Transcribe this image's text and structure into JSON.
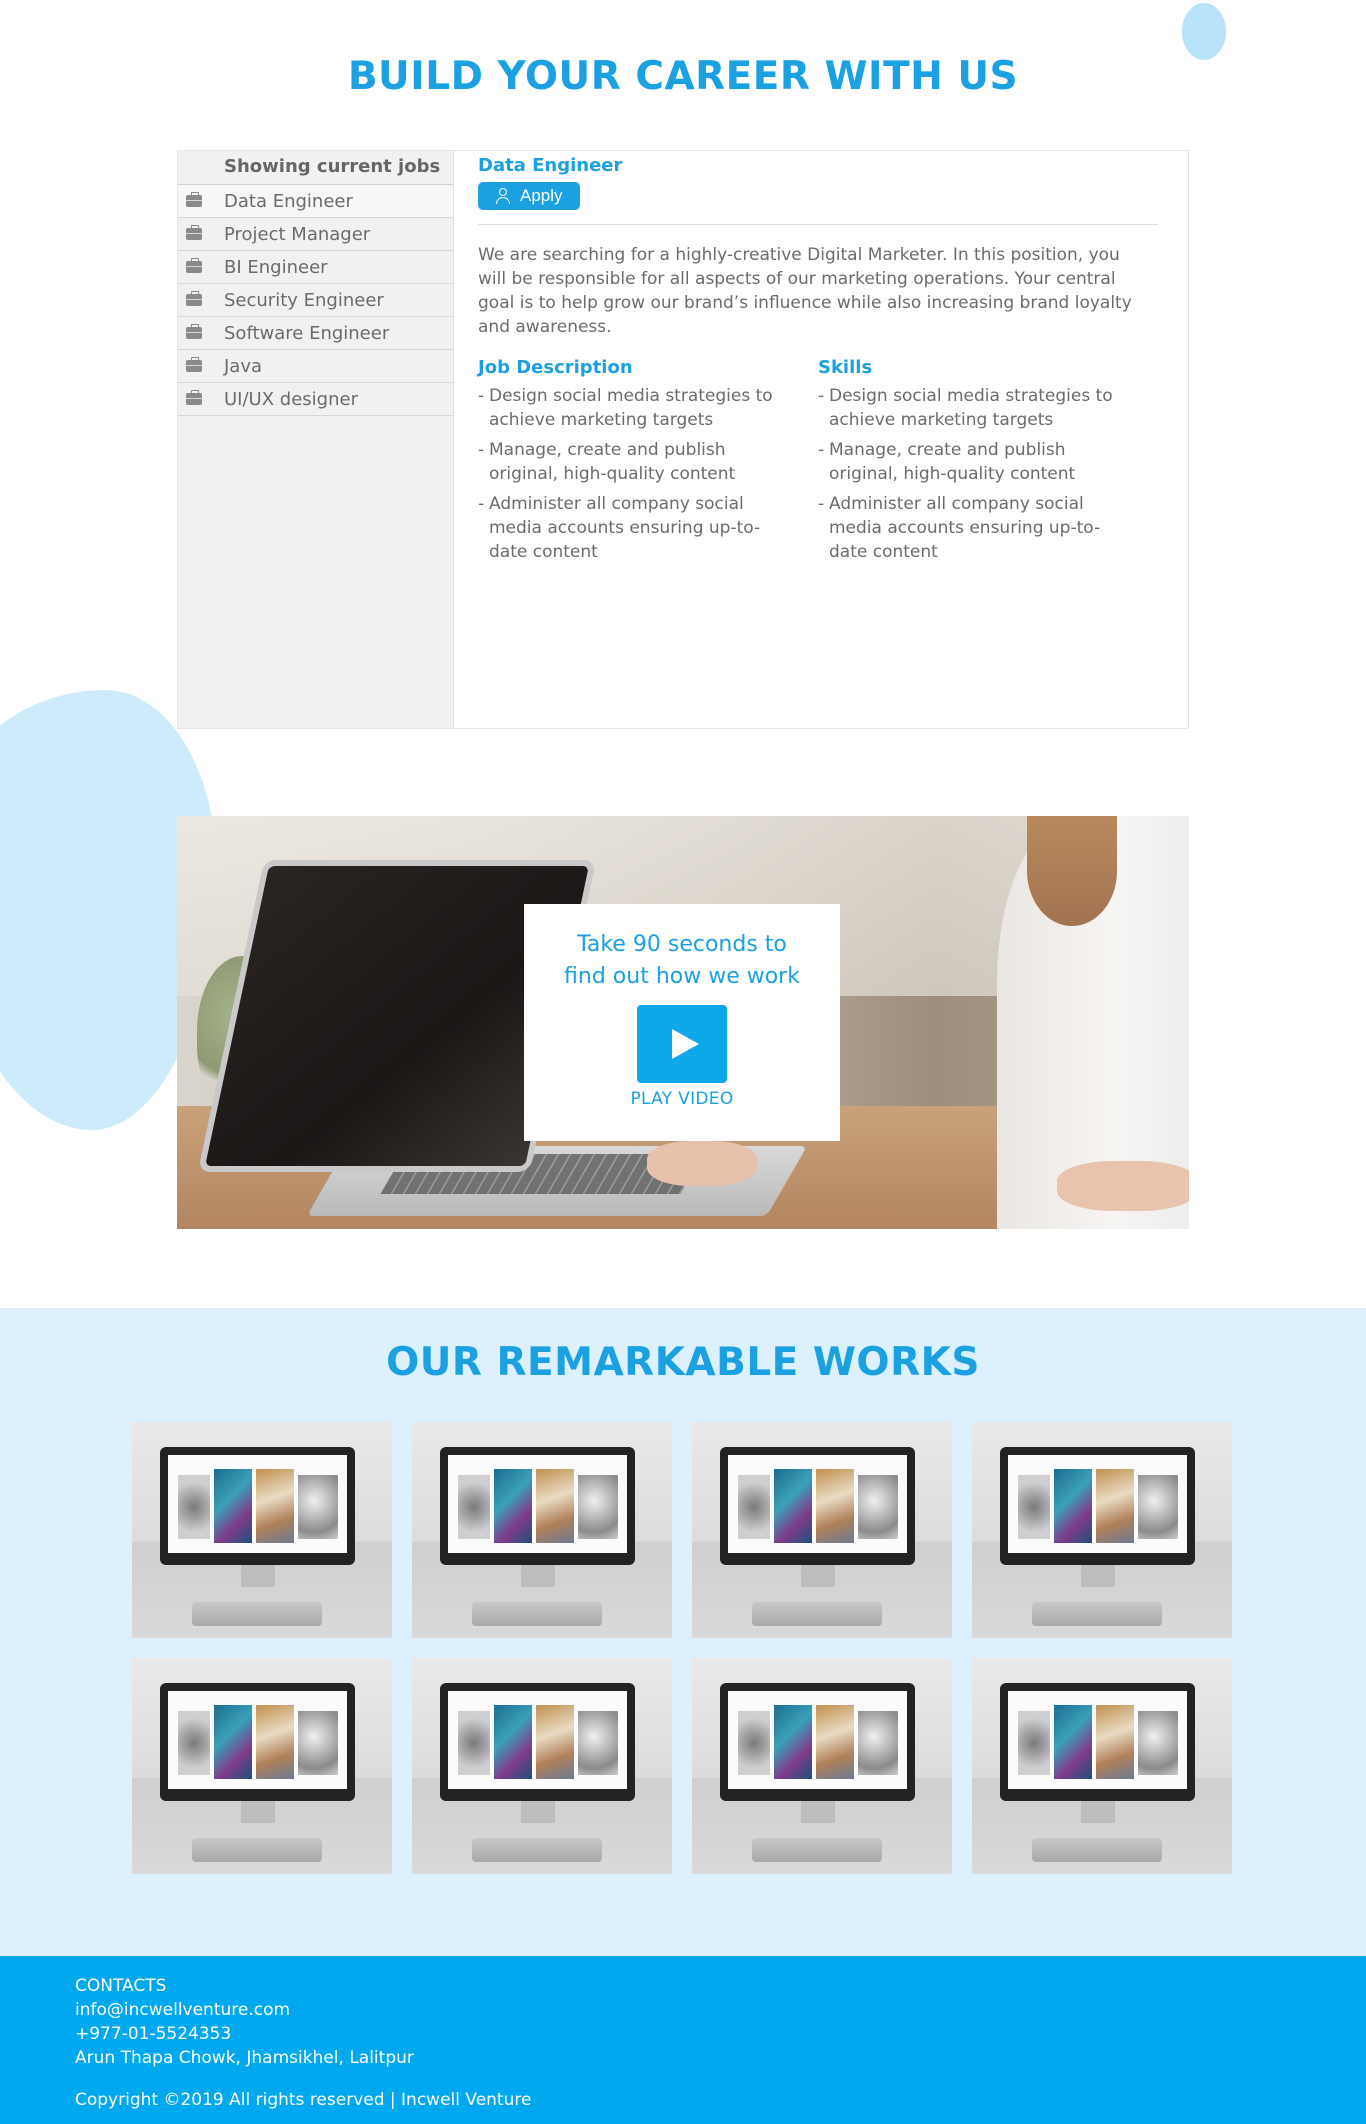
{
  "careers": {
    "title": "BUILD YOUR CAREER WITH US",
    "sidebar_heading": "Showing current jobs",
    "jobs": [
      {
        "label": "Data Engineer"
      },
      {
        "label": "Project Manager"
      },
      {
        "label": "BI Engineer"
      },
      {
        "label": "Security Engineer"
      },
      {
        "label": "Software Engineer"
      },
      {
        "label": "Java"
      },
      {
        "label": "UI/UX designer"
      }
    ],
    "selected_job": {
      "title": "Data Engineer",
      "apply_label": "Apply",
      "description": "We are searching for a highly-creative Digital Marketer. In this position, you will be responsible for all aspects of our marketing operations. Your central goal is to help grow our brand’s influence while also increasing brand loyalty and awareness.",
      "job_description_title": "Job Description",
      "job_description_items": [
        "Design social media strategies to achieve marketing targets",
        "Manage, create and publish original, high-quality content",
        "Administer all company social media accounts ensuring up-to-date content"
      ],
      "skills_title": "Skills",
      "skills_items": [
        "Design social media strategies to achieve marketing targets",
        "Manage, create and publish original, high-quality content",
        "Administer all company social media accounts ensuring up-to-date content"
      ]
    }
  },
  "video": {
    "text": "Take 90 seconds to find out how we work",
    "play_label": "PLAY VIDEO"
  },
  "works": {
    "title": "OUR REMARKABLE WORKS"
  },
  "footer": {
    "contacts_label": "CONTACTS",
    "email": "info@incwellventure.com",
    "phone": "+977-01-5524353",
    "address": "Arun Thapa Chowk, Jhamsikhel, Lalitpur",
    "copyright": "Copyright ©2019 All rights reserved | Incwell Venture"
  },
  "colors": {
    "accent": "#1ba1e2",
    "footer_bg": "#00a8ef",
    "works_bg": "#dcf1fd",
    "sidebar_bg": "#f1f1f1"
  },
  "icons": {
    "job_item": "briefcase-icon",
    "apply": "user-icon",
    "video": "play-icon"
  }
}
